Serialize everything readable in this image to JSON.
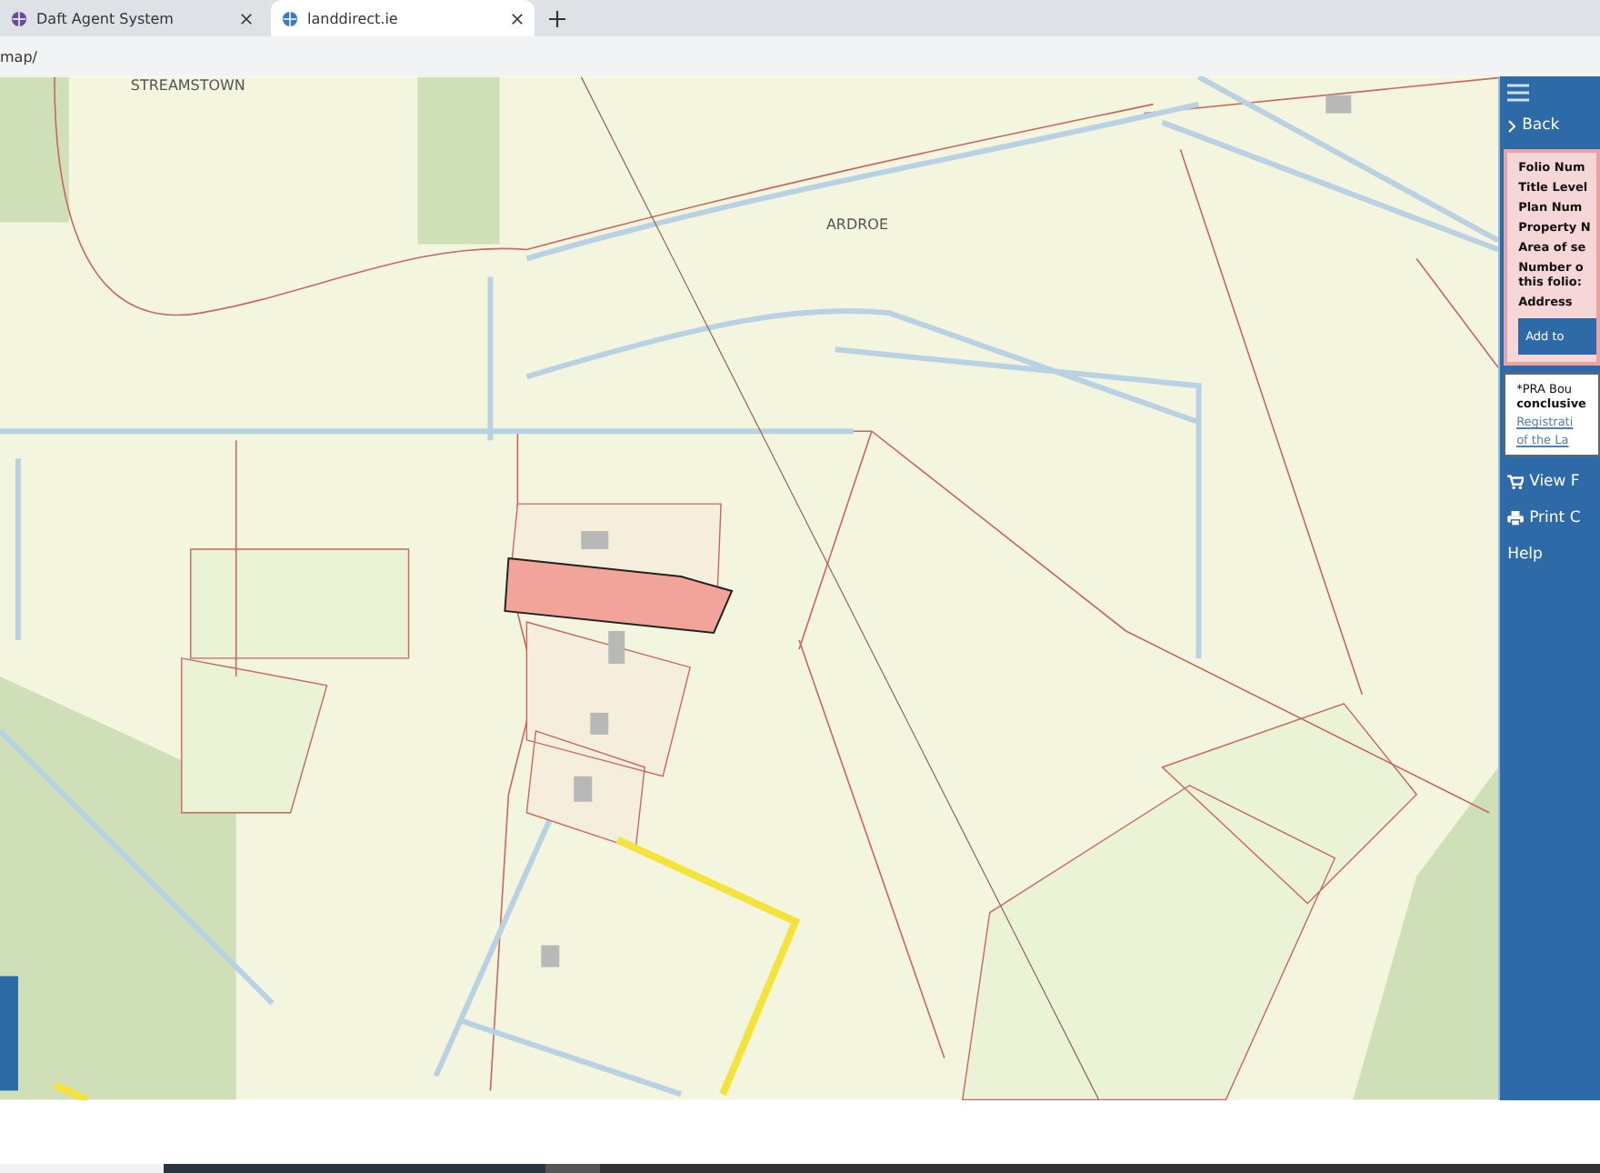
{
  "browser": {
    "tabs": [
      {
        "title": "Daft Agent System",
        "selected": false
      },
      {
        "title": "landdirect.ie",
        "selected": true
      }
    ],
    "url": "map/"
  },
  "map": {
    "place_labels": [
      "STREAMSTOWN",
      "ARDROE"
    ]
  },
  "sidebar": {
    "back": "Back",
    "folio_fields": [
      "Folio Num",
      "Title Level",
      "Plan Num",
      "Property N",
      "Area of se",
      "Number o this folio:",
      "Address"
    ],
    "add_button": "Add to",
    "disclaimer": "*PRA Bou **conclusive**",
    "links": [
      "Registrati",
      "of the La"
    ],
    "menu": [
      {
        "label": "View F",
        "kind": "cart"
      },
      {
        "label": "Print C",
        "kind": "print"
      },
      {
        "label": "Help",
        "kind": "plain"
      }
    ]
  }
}
